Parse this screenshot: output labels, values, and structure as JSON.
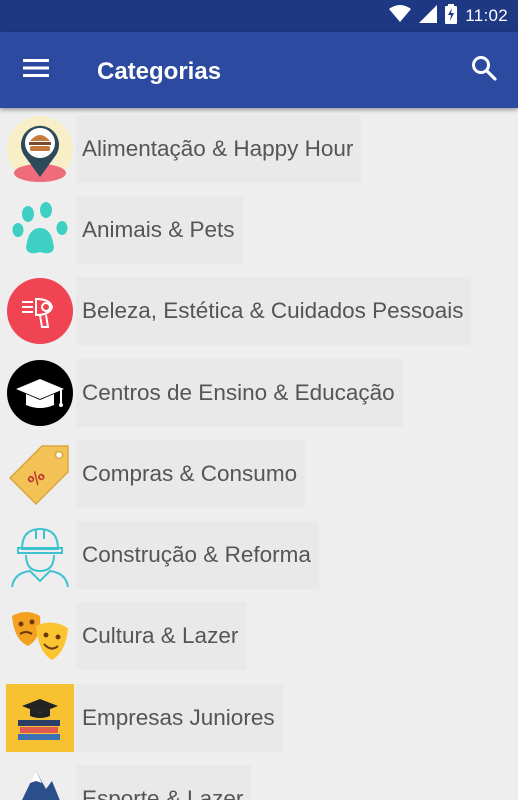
{
  "status_bar": {
    "time": "11:02",
    "icons": [
      "wifi-icon",
      "cellular-signal-icon",
      "battery-charging-icon"
    ]
  },
  "app_bar": {
    "title": "Categorias",
    "menu_icon": "hamburger-menu-icon",
    "search_icon": "search-icon",
    "color": "#2b4aa0"
  },
  "categories": [
    {
      "label": "Alimentação & Happy Hour",
      "icon": "burger-location-pin-icon"
    },
    {
      "label": "Animais & Pets",
      "icon": "paw-icon"
    },
    {
      "label": "Beleza, Estética & Cuidados Pessoais",
      "icon": "hair-dryer-icon"
    },
    {
      "label": "Centros de Ensino & Educação",
      "icon": "graduation-cap-icon"
    },
    {
      "label": "Compras & Consumo",
      "icon": "price-tag-icon"
    },
    {
      "label": "Construção & Reforma",
      "icon": "construction-worker-icon"
    },
    {
      "label": "Cultura & Lazer",
      "icon": "theater-masks-icon"
    },
    {
      "label": "Empresas Juniores",
      "icon": "books-graduation-icon"
    },
    {
      "label": "Esporte & Lazer",
      "icon": "mountain-icon"
    }
  ]
}
